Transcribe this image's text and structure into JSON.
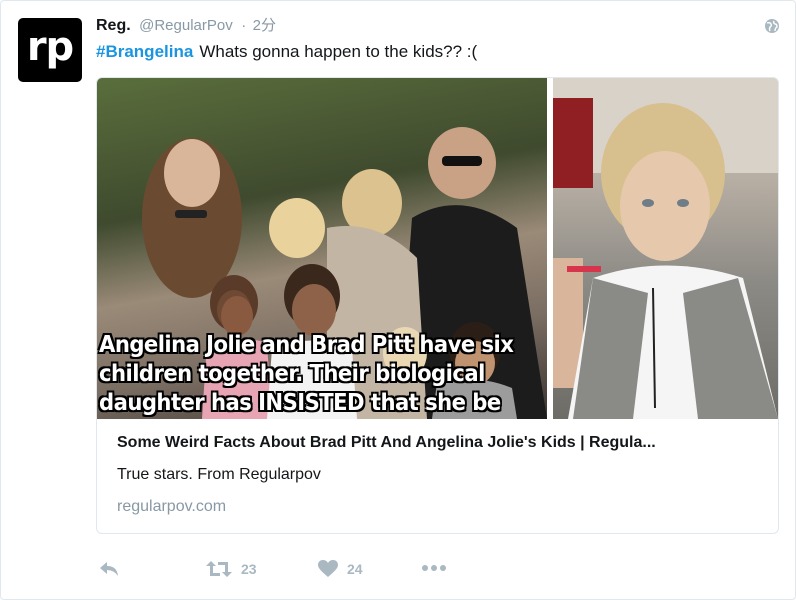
{
  "tweet": {
    "avatar_text": "rp",
    "display_name": "Reg.",
    "handle": "@RegularPov",
    "separator": "·",
    "time": "2分",
    "hashtag": "#Brangelina",
    "text": "Whats gonna happen to the kids?? :("
  },
  "card": {
    "image_overlay_lines": [
      "Angelina Jolie and Brad Pitt have six",
      "children together. Their biological",
      "daughter has INSISTED that she be"
    ],
    "title": "Some Weird Facts About Brad Pitt And Angelina Jolie's Kids | Regula...",
    "description": "True stars. From Regularpov",
    "domain": "regularpov.com"
  },
  "actions": {
    "reply_icon": "reply-icon",
    "retweet_icon": "retweet-icon",
    "retweet_count": "23",
    "like_icon": "heart-icon",
    "like_count": "24",
    "more_icon": "more-icon"
  },
  "colors": {
    "link": "#1b95e0",
    "muted": "#8899a6",
    "icon": "#aab8c2",
    "border": "#e1e8ed"
  }
}
